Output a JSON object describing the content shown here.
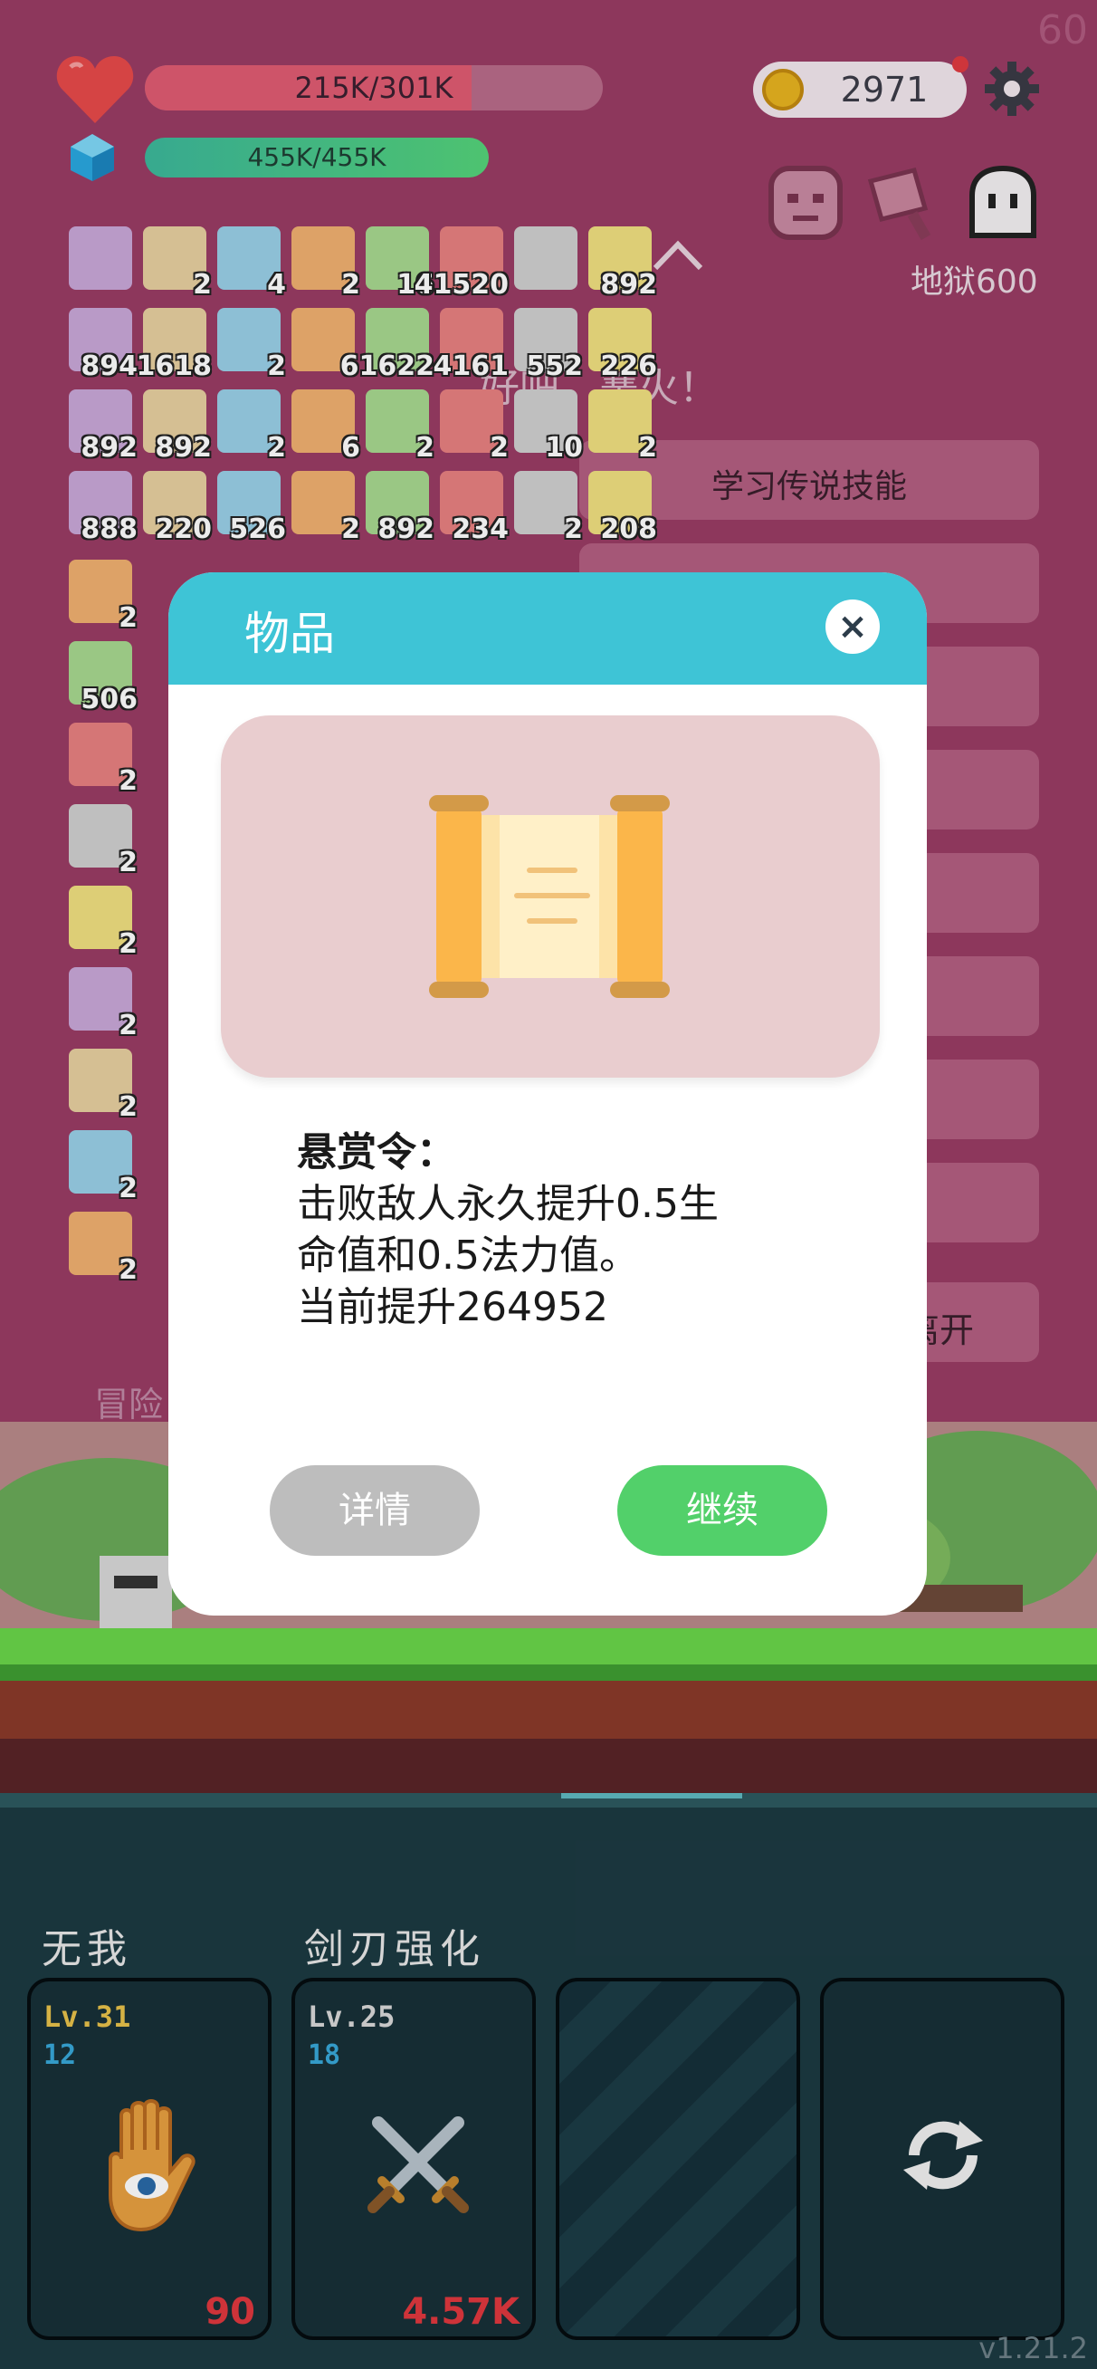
{
  "fps": "60",
  "hud": {
    "hp_text": "215K/301K",
    "hp_fraction": 0.714,
    "mp_text": "455K/455K",
    "coins": "2971",
    "hell_level": "地狱600"
  },
  "inventory": [
    {
      "icon": "card-icon",
      "count": ""
    },
    {
      "icon": "card-icon",
      "count": "2"
    },
    {
      "icon": "fan-icon",
      "count": "4"
    },
    {
      "icon": "card-icon",
      "count": "2"
    },
    {
      "icon": "scroll-icon",
      "count": "16"
    },
    {
      "icon": "letter-icon",
      "count": "41520"
    },
    {
      "icon": "sword-icon",
      "count": ""
    },
    {
      "icon": "potion-icon",
      "count": "892"
    },
    {
      "icon": "bottle-icon",
      "count": "894"
    },
    {
      "icon": "book-icon",
      "count": "1618"
    },
    {
      "icon": "compass-icon",
      "count": "2"
    },
    {
      "icon": "bulb-icon",
      "count": ""
    },
    {
      "icon": "apple-icon",
      "count": "61622"
    },
    {
      "icon": "sword-icon",
      "count": "4161"
    },
    {
      "icon": "watermelon-icon",
      "count": "552"
    },
    {
      "icon": "flower-icon",
      "count": "226"
    },
    {
      "icon": "chat-icon",
      "count": "892"
    },
    {
      "icon": "key-icon",
      "count": "892"
    },
    {
      "icon": "chest-icon",
      "count": "2"
    },
    {
      "icon": "map-icon",
      "count": "6"
    },
    {
      "icon": "wizard-hat-icon",
      "count": "2"
    },
    {
      "icon": "icecream-icon",
      "count": "2"
    },
    {
      "icon": "knife-icon",
      "count": "10"
    },
    {
      "icon": "fire-icon",
      "count": "2"
    },
    {
      "icon": "beer-icon",
      "count": "888"
    },
    {
      "icon": "pineapple-icon",
      "count": "220"
    },
    {
      "icon": "sunflower-icon",
      "count": "526"
    },
    {
      "icon": "cards-icon",
      "count": "2"
    },
    {
      "icon": "shield-icon",
      "count": "892"
    },
    {
      "icon": "flag-icon",
      "count": "234"
    },
    {
      "icon": "note-icon",
      "count": "2"
    },
    {
      "icon": "claw-icon",
      "count": "208"
    }
  ],
  "inventory_left": [
    {
      "icon": "star-card-icon",
      "count": "2"
    },
    {
      "icon": "pineapple-icon",
      "count": "506"
    },
    {
      "icon": "hook-icon",
      "count": "2"
    },
    {
      "icon": "cloth-icon",
      "count": "2"
    },
    {
      "icon": "mushroom-icon",
      "count": "2"
    },
    {
      "icon": "eagle-icon",
      "count": "2"
    },
    {
      "icon": "location-icon",
      "count": "2"
    },
    {
      "icon": "tombstone-icon",
      "count": "2"
    },
    {
      "icon": "hood-icon",
      "count": "2"
    }
  ],
  "background_text": {
    "bonfire": "好吧，篝火！",
    "learn_skill": "学习传说技能",
    "leave": "离开",
    "adventure": "冒险"
  },
  "modal": {
    "title": "物品",
    "close": "×",
    "item_name": "悬赏令：",
    "desc_line1": "击败敌人永久提升0.5生",
    "desc_line2": "命值和0.5法力值。",
    "desc_line3": "当前提升264952",
    "detail_button": "详情",
    "continue_button": "继续"
  },
  "skills": [
    {
      "name": "无我",
      "level": "Lv.31",
      "sub": "12",
      "cost": "90",
      "icon": "hand-eye-icon"
    },
    {
      "name": "剑刃强化",
      "level": "Lv.25",
      "sub": "18",
      "cost": "4.57K",
      "icon": "crossed-swords-icon"
    },
    {
      "name": "",
      "level": "",
      "sub": "",
      "cost": "",
      "icon": "empty-slot"
    },
    {
      "name": "",
      "level": "",
      "sub": "",
      "cost": "",
      "icon": "refresh-icon"
    }
  ],
  "version": "v1.21.2",
  "colors": {
    "modal_header": "#3ec4d6",
    "continue": "#52d06a",
    "detail": "#bdbdbd",
    "level_gold": "#e8c24a",
    "cost_red": "#e0383e"
  }
}
